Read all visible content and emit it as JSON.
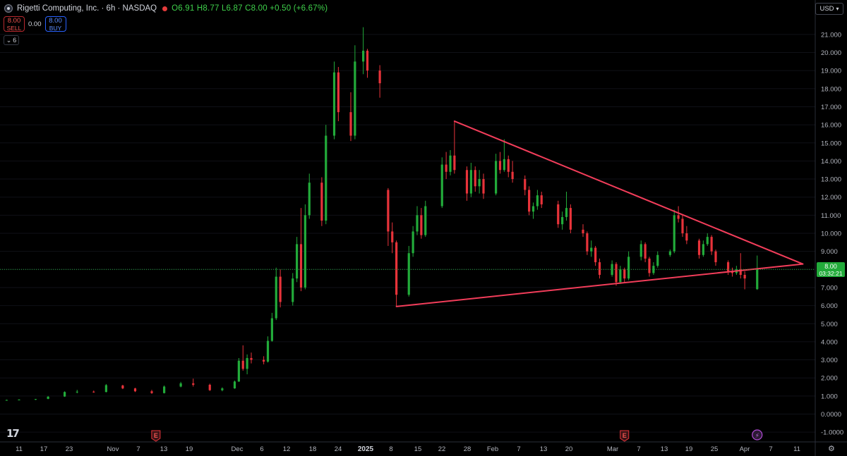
{
  "header": {
    "title": "Rigetti Computing, Inc. · 6h · NASDAQ",
    "ohlc": "O6.91 H8.77 L6.87 C8.00 +0.50 (+6.67%)",
    "sell_price": "8.00",
    "sell_label": "SELL",
    "spread": "0.00",
    "buy_price": "8.00",
    "buy_label": "BUY",
    "collapse_count": "6",
    "currency": "USD"
  },
  "price_tag": {
    "price": "8.00",
    "countdown": "03:32:21"
  },
  "colors": {
    "up": "#22ab3a",
    "down": "#e8333a",
    "trendline": "#f23d5a",
    "background": "#000000",
    "accent_green": "#3fd14b"
  },
  "icons": [
    "symbol-icon",
    "market-status-icon",
    "earnings-icon",
    "dividend-icon",
    "tradingview-logo-icon",
    "settings-icon"
  ],
  "chart_data": {
    "type": "candlestick",
    "title": "Rigetti Computing, Inc. · 6h · NASDAQ",
    "y_ticks": [
      "21.000",
      "20.000",
      "19.000",
      "18.000",
      "17.000",
      "16.000",
      "15.000",
      "14.000",
      "13.000",
      "12.000",
      "11.000",
      "10.000",
      "9.000",
      "8.000",
      "7.000",
      "6.000",
      "5.000",
      "4.000",
      "3.000",
      "2.000",
      "1.000",
      "0.0000",
      "-1.0000"
    ],
    "x_ticks": [
      "11",
      "17",
      "23",
      "Nov",
      "7",
      "13",
      "19",
      "Dec",
      "6",
      "12",
      "18",
      "24",
      "2025",
      "8",
      "15",
      "22",
      "28",
      "Feb",
      "7",
      "13",
      "20",
      "Mar",
      "7",
      "13",
      "19",
      "25",
      "Apr",
      "7",
      "11"
    ],
    "ylim": [
      -1.2,
      21.8
    ],
    "last_price": 8.0,
    "trendlines": [
      {
        "name": "upper",
        "from": {
          "date": "2025-01-24",
          "price": 16.2
        },
        "to": {
          "date": "2025-04-18",
          "price": 8.3
        }
      },
      {
        "name": "lower",
        "from": {
          "date": "2025-01-10",
          "price": 5.95
        },
        "to": {
          "date": "2025-04-18",
          "price": 8.3
        }
      }
    ],
    "events": [
      {
        "type": "earnings",
        "label": "E",
        "date": "2024-11-13"
      },
      {
        "type": "earnings",
        "label": "E",
        "date": "2025-03-06"
      },
      {
        "type": "dividend",
        "label": "⚡",
        "date": "2025-04-07"
      }
    ],
    "candles": [
      {
        "date": "2024-10-08",
        "o": 0.78,
        "h": 0.8,
        "l": 0.76,
        "c": 0.78
      },
      {
        "date": "2024-10-11",
        "o": 0.78,
        "h": 0.82,
        "l": 0.76,
        "c": 0.8
      },
      {
        "date": "2024-10-15",
        "o": 0.8,
        "h": 0.84,
        "l": 0.78,
        "c": 0.83
      },
      {
        "date": "2024-10-18",
        "o": 0.84,
        "h": 1.0,
        "l": 0.82,
        "c": 0.96
      },
      {
        "date": "2024-10-22",
        "o": 0.97,
        "h": 1.26,
        "l": 0.95,
        "c": 1.22
      },
      {
        "date": "2024-10-25",
        "o": 1.22,
        "h": 1.34,
        "l": 1.15,
        "c": 1.24
      },
      {
        "date": "2024-10-29",
        "o": 1.24,
        "h": 1.3,
        "l": 1.18,
        "c": 1.22
      },
      {
        "date": "2024-11-01",
        "o": 1.22,
        "h": 1.66,
        "l": 1.2,
        "c": 1.6
      },
      {
        "date": "2024-11-05",
        "o": 1.58,
        "h": 1.62,
        "l": 1.38,
        "c": 1.42
      },
      {
        "date": "2024-11-08",
        "o": 1.42,
        "h": 1.45,
        "l": 1.22,
        "c": 1.26
      },
      {
        "date": "2024-11-12",
        "o": 1.26,
        "h": 1.34,
        "l": 1.12,
        "c": 1.16
      },
      {
        "date": "2024-11-15",
        "o": 1.16,
        "h": 1.58,
        "l": 1.14,
        "c": 1.52
      },
      {
        "date": "2024-11-19",
        "o": 1.52,
        "h": 1.78,
        "l": 1.48,
        "c": 1.7
      },
      {
        "date": "2024-11-22",
        "o": 1.7,
        "h": 1.96,
        "l": 1.52,
        "c": 1.62
      },
      {
        "date": "2024-11-26",
        "o": 1.62,
        "h": 1.68,
        "l": 1.28,
        "c": 1.32
      },
      {
        "date": "2024-11-29",
        "o": 1.32,
        "h": 1.48,
        "l": 1.26,
        "c": 1.42
      },
      {
        "date": "2024-12-02",
        "o": 1.42,
        "h": 1.85,
        "l": 1.4,
        "c": 1.8
      },
      {
        "date": "2024-12-03",
        "o": 1.8,
        "h": 3.1,
        "l": 1.78,
        "c": 2.95
      },
      {
        "date": "2024-12-04",
        "o": 2.95,
        "h": 3.8,
        "l": 2.4,
        "c": 2.5
      },
      {
        "date": "2024-12-05",
        "o": 2.5,
        "h": 3.3,
        "l": 2.2,
        "c": 3.1
      },
      {
        "date": "2024-12-06",
        "o": 3.1,
        "h": 3.4,
        "l": 2.8,
        "c": 3.0
      },
      {
        "date": "2024-12-09",
        "o": 3.0,
        "h": 3.2,
        "l": 2.75,
        "c": 2.9
      },
      {
        "date": "2024-12-10",
        "o": 2.9,
        "h": 4.3,
        "l": 2.85,
        "c": 4.05
      },
      {
        "date": "2024-12-11",
        "o": 4.05,
        "h": 5.6,
        "l": 4.0,
        "c": 5.3
      },
      {
        "date": "2024-12-12",
        "o": 5.3,
        "h": 8.1,
        "l": 5.2,
        "c": 7.6
      },
      {
        "date": "2024-12-13",
        "o": 7.6,
        "h": 8.0,
        "l": 5.9,
        "c": 6.2
      },
      {
        "date": "2024-12-16",
        "o": 6.2,
        "h": 7.8,
        "l": 6.0,
        "c": 7.5
      },
      {
        "date": "2024-12-17",
        "o": 7.5,
        "h": 9.8,
        "l": 7.3,
        "c": 9.4
      },
      {
        "date": "2024-12-18",
        "o": 9.4,
        "h": 11.4,
        "l": 6.8,
        "c": 7.0
      },
      {
        "date": "2024-12-19",
        "o": 7.0,
        "h": 11.6,
        "l": 6.9,
        "c": 11.0
      },
      {
        "date": "2024-12-20",
        "o": 11.0,
        "h": 13.3,
        "l": 10.8,
        "c": 12.8
      },
      {
        "date": "2024-12-23",
        "o": 12.8,
        "h": 13.1,
        "l": 10.4,
        "c": 10.7
      },
      {
        "date": "2024-12-24",
        "o": 10.7,
        "h": 16.0,
        "l": 10.5,
        "c": 15.4
      },
      {
        "date": "2024-12-26",
        "o": 15.4,
        "h": 19.5,
        "l": 15.2,
        "c": 18.9
      },
      {
        "date": "2024-12-27",
        "o": 18.9,
        "h": 19.2,
        "l": 16.2,
        "c": 16.7
      },
      {
        "date": "2024-12-30",
        "o": 16.7,
        "h": 17.8,
        "l": 15.1,
        "c": 15.4
      },
      {
        "date": "2024-12-31",
        "o": 15.4,
        "h": 20.4,
        "l": 15.2,
        "c": 19.5
      },
      {
        "date": "2025-01-02",
        "o": 19.5,
        "h": 21.4,
        "l": 18.8,
        "c": 20.1
      },
      {
        "date": "2025-01-03",
        "o": 20.1,
        "h": 20.2,
        "l": 18.6,
        "c": 19.0
      },
      {
        "date": "2025-01-06",
        "o": 19.0,
        "h": 19.3,
        "l": 17.5,
        "c": 18.3
      },
      {
        "date": "2025-01-08",
        "o": 12.4,
        "h": 12.5,
        "l": 9.3,
        "c": 10.1
      },
      {
        "date": "2025-01-09",
        "o": 10.1,
        "h": 10.6,
        "l": 8.9,
        "c": 9.5
      },
      {
        "date": "2025-01-10",
        "o": 9.5,
        "h": 9.6,
        "l": 5.95,
        "c": 6.6
      },
      {
        "date": "2025-01-13",
        "o": 6.6,
        "h": 9.3,
        "l": 6.5,
        "c": 8.9
      },
      {
        "date": "2025-01-14",
        "o": 8.9,
        "h": 10.4,
        "l": 8.7,
        "c": 10.1
      },
      {
        "date": "2025-01-15",
        "o": 10.1,
        "h": 11.5,
        "l": 9.9,
        "c": 11.0
      },
      {
        "date": "2025-01-16",
        "o": 11.0,
        "h": 11.4,
        "l": 9.7,
        "c": 9.9
      },
      {
        "date": "2025-01-17",
        "o": 9.9,
        "h": 11.8,
        "l": 9.8,
        "c": 11.5
      },
      {
        "date": "2025-01-21",
        "o": 11.5,
        "h": 14.2,
        "l": 11.4,
        "c": 13.8
      },
      {
        "date": "2025-01-22",
        "o": 13.8,
        "h": 14.5,
        "l": 13.0,
        "c": 13.4
      },
      {
        "date": "2025-01-23",
        "o": 13.4,
        "h": 14.6,
        "l": 13.2,
        "c": 14.3
      },
      {
        "date": "2025-01-24",
        "o": 14.3,
        "h": 16.2,
        "l": 13.3,
        "c": 13.5
      },
      {
        "date": "2025-01-27",
        "o": 13.5,
        "h": 13.7,
        "l": 11.8,
        "c": 12.2
      },
      {
        "date": "2025-01-28",
        "o": 12.2,
        "h": 13.9,
        "l": 12.0,
        "c": 13.5
      },
      {
        "date": "2025-01-29",
        "o": 13.5,
        "h": 13.7,
        "l": 12.3,
        "c": 12.6
      },
      {
        "date": "2025-01-30",
        "o": 12.6,
        "h": 13.5,
        "l": 12.2,
        "c": 13.0
      },
      {
        "date": "2025-01-31",
        "o": 13.0,
        "h": 13.3,
        "l": 11.9,
        "c": 12.2
      },
      {
        "date": "2025-02-03",
        "o": 12.2,
        "h": 14.4,
        "l": 12.1,
        "c": 14.0
      },
      {
        "date": "2025-02-04",
        "o": 14.0,
        "h": 14.5,
        "l": 13.3,
        "c": 13.5
      },
      {
        "date": "2025-02-05",
        "o": 13.5,
        "h": 15.2,
        "l": 13.4,
        "c": 14.1
      },
      {
        "date": "2025-02-06",
        "o": 14.1,
        "h": 14.3,
        "l": 13.1,
        "c": 13.4
      },
      {
        "date": "2025-02-07",
        "o": 13.4,
        "h": 14.0,
        "l": 12.8,
        "c": 13.0
      },
      {
        "date": "2025-02-10",
        "o": 13.0,
        "h": 13.2,
        "l": 12.1,
        "c": 12.4
      },
      {
        "date": "2025-02-11",
        "o": 12.4,
        "h": 12.6,
        "l": 11.0,
        "c": 11.2
      },
      {
        "date": "2025-02-12",
        "o": 11.2,
        "h": 11.7,
        "l": 10.8,
        "c": 11.5
      },
      {
        "date": "2025-02-13",
        "o": 11.5,
        "h": 12.4,
        "l": 11.3,
        "c": 12.1
      },
      {
        "date": "2025-02-14",
        "o": 12.1,
        "h": 12.3,
        "l": 11.4,
        "c": 11.6
      },
      {
        "date": "2025-02-18",
        "o": 11.6,
        "h": 11.8,
        "l": 10.3,
        "c": 10.5
      },
      {
        "date": "2025-02-19",
        "o": 10.5,
        "h": 11.2,
        "l": 10.2,
        "c": 10.9
      },
      {
        "date": "2025-02-20",
        "o": 10.9,
        "h": 12.3,
        "l": 10.7,
        "c": 11.4
      },
      {
        "date": "2025-02-21",
        "o": 11.4,
        "h": 11.6,
        "l": 10.0,
        "c": 10.2
      },
      {
        "date": "2025-02-24",
        "o": 10.2,
        "h": 10.5,
        "l": 9.8,
        "c": 10.0
      },
      {
        "date": "2025-02-25",
        "o": 10.0,
        "h": 10.1,
        "l": 8.8,
        "c": 9.0
      },
      {
        "date": "2025-02-26",
        "o": 9.0,
        "h": 9.6,
        "l": 8.7,
        "c": 9.2
      },
      {
        "date": "2025-02-27",
        "o": 9.2,
        "h": 9.3,
        "l": 8.2,
        "c": 8.4
      },
      {
        "date": "2025-02-28",
        "o": 8.4,
        "h": 8.6,
        "l": 7.5,
        "c": 7.7
      },
      {
        "date": "2025-03-03",
        "o": 7.7,
        "h": 8.5,
        "l": 7.6,
        "c": 8.3
      },
      {
        "date": "2025-03-04",
        "o": 8.3,
        "h": 8.4,
        "l": 7.1,
        "c": 7.3
      },
      {
        "date": "2025-03-05",
        "o": 7.3,
        "h": 8.2,
        "l": 7.2,
        "c": 8.0
      },
      {
        "date": "2025-03-06",
        "o": 8.0,
        "h": 8.1,
        "l": 7.3,
        "c": 7.5
      },
      {
        "date": "2025-03-07",
        "o": 7.5,
        "h": 9.0,
        "l": 7.4,
        "c": 8.7
      },
      {
        "date": "2025-03-10",
        "o": 8.7,
        "h": 9.6,
        "l": 8.5,
        "c": 9.4
      },
      {
        "date": "2025-03-11",
        "o": 9.4,
        "h": 9.5,
        "l": 8.4,
        "c": 8.6
      },
      {
        "date": "2025-03-12",
        "o": 8.6,
        "h": 8.7,
        "l": 7.6,
        "c": 7.8
      },
      {
        "date": "2025-03-13",
        "o": 7.8,
        "h": 8.4,
        "l": 7.7,
        "c": 8.2
      },
      {
        "date": "2025-03-14",
        "o": 8.2,
        "h": 9.0,
        "l": 8.1,
        "c": 8.8
      },
      {
        "date": "2025-03-17",
        "o": 8.8,
        "h": 9.1,
        "l": 8.7,
        "c": 9.0
      },
      {
        "date": "2025-03-18",
        "o": 9.0,
        "h": 11.3,
        "l": 8.9,
        "c": 11.0
      },
      {
        "date": "2025-03-19",
        "o": 11.0,
        "h": 11.5,
        "l": 10.6,
        "c": 10.8
      },
      {
        "date": "2025-03-20",
        "o": 10.8,
        "h": 11.0,
        "l": 9.8,
        "c": 10.0
      },
      {
        "date": "2025-03-21",
        "o": 10.0,
        "h": 10.4,
        "l": 9.4,
        "c": 9.6
      },
      {
        "date": "2025-03-24",
        "o": 9.6,
        "h": 9.7,
        "l": 8.6,
        "c": 8.8
      },
      {
        "date": "2025-03-25",
        "o": 8.8,
        "h": 9.6,
        "l": 8.7,
        "c": 9.4
      },
      {
        "date": "2025-03-26",
        "o": 9.4,
        "h": 10.0,
        "l": 9.3,
        "c": 9.8
      },
      {
        "date": "2025-03-27",
        "o": 9.8,
        "h": 9.9,
        "l": 8.8,
        "c": 9.0
      },
      {
        "date": "2025-03-28",
        "o": 9.0,
        "h": 9.1,
        "l": 8.2,
        "c": 8.4
      },
      {
        "date": "2025-03-31",
        "o": 8.4,
        "h": 8.5,
        "l": 7.7,
        "c": 7.9
      },
      {
        "date": "2025-04-01",
        "o": 7.9,
        "h": 8.1,
        "l": 7.6,
        "c": 7.8
      },
      {
        "date": "2025-04-02",
        "o": 7.8,
        "h": 8.2,
        "l": 7.7,
        "c": 8.0
      },
      {
        "date": "2025-04-03",
        "o": 8.0,
        "h": 8.9,
        "l": 7.5,
        "c": 7.7
      },
      {
        "date": "2025-04-04",
        "o": 7.7,
        "h": 7.9,
        "l": 6.9,
        "c": 7.5
      },
      {
        "date": "2025-04-07",
        "o": 6.91,
        "h": 8.77,
        "l": 6.87,
        "c": 8.0
      }
    ]
  }
}
